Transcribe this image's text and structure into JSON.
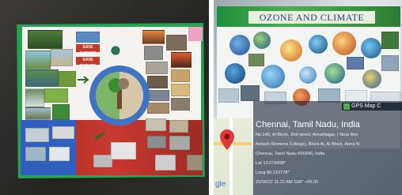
{
  "left_photo": {
    "poster_tags": [
      "SAVE NATURE",
      "SAVE FUTURE"
    ]
  },
  "right_photo": {
    "poster_title": "OZONE AND CLIMATE",
    "gps_overlay": {
      "app_label": "GPS Map C",
      "city": "Chennai, Tamil Nadu, India",
      "address_line1": "No:140, Al Block, 2nd street, AnnaNagar, ( Near Ann",
      "address_line2": "Ardash Womens College), Block Al, Al Block, Anna N",
      "address_line3": "Chennai, Tamil Nadu 600040, India",
      "lat": "Lat 13.079458°",
      "long": "Long 80.210778°",
      "datetime": "20/09/22 11:22 AM GMT +05:30",
      "map_watermark": "gle"
    }
  },
  "icons": [
    "map-pin-icon",
    "gps-camera-icon",
    "globe-icon",
    "earth-diagram"
  ]
}
